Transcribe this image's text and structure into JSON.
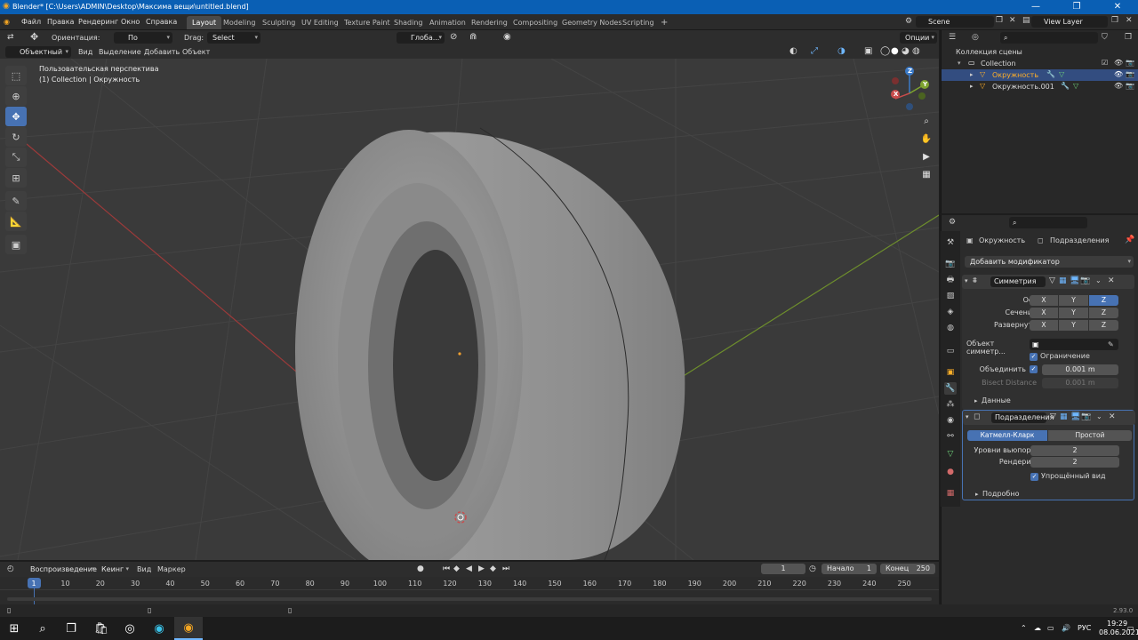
{
  "window": {
    "title": "Blender* [C:\\Users\\ADMIN\\Desktop\\Максима вещи\\untitled.blend]"
  },
  "menu": [
    "Файл",
    "Правка",
    "Рендеринг",
    "Окно",
    "Справка"
  ],
  "workspaces": [
    "Layout",
    "Modeling",
    "Sculpting",
    "UV Editing",
    "Texture Paint",
    "Shading",
    "Animation",
    "Rendering",
    "Compositing",
    "Geometry Nodes",
    "Scripting"
  ],
  "scene": {
    "name": "Scene",
    "view_layer": "View Layer"
  },
  "header3d": {
    "orientation_label": "Ориентация:",
    "orientation_value": "По умолч...",
    "drag_label": "Drag:",
    "drag_value": "Select Box",
    "transform_orientation": "Глоба...",
    "options": "Опции",
    "mode": "Объектный ...",
    "view": "Вид",
    "select": "Выделение",
    "add": "Добавить",
    "object": "Объект"
  },
  "viewport": {
    "perspective": "Пользовательская перспектива",
    "collection_info": "(1) Collection | Окружность",
    "axes": [
      "X",
      "Y",
      "Z"
    ]
  },
  "outliner": {
    "root": "Коллекция сцены",
    "collection": "Collection",
    "items": [
      "Окружность",
      "Окружность.001"
    ]
  },
  "properties": {
    "object_name": "Окружность",
    "context": "Подразделения",
    "add_modifier": "Добавить модификатор",
    "mirror": {
      "name": "Симметрия",
      "axis_label": "Ось",
      "bisect_label": "Сечение",
      "flip_label": "Развернуть",
      "xyz": [
        "X",
        "Y",
        "Z"
      ],
      "mirror_object_label": "Объект симметр...",
      "clipping": "Ограничение",
      "merge_label": "Объединить",
      "merge_value": "0.001 m",
      "bisect_distance_label": "Bisect Distance",
      "bisect_distance_value": "0.001 m",
      "data": "Данные"
    },
    "subsurf": {
      "name": "Подразделения",
      "catmull": "Катмелл-Кларк",
      "simple": "Простой",
      "levels_viewport_label": "Уровни вьюпорта",
      "levels_viewport": "2",
      "render_label": "Рендеринг",
      "render": "2",
      "optimal": "Упрощённый вид",
      "advanced": "Подробно"
    }
  },
  "timeline": {
    "playback": "Воспроизведение",
    "keying": "Кеинг",
    "view": "Вид",
    "marker": "Маркер",
    "current_frame": "1",
    "start_label": "Начало",
    "start": "1",
    "end_label": "Конец",
    "end": "250",
    "ticks": [
      "1",
      "10",
      "20",
      "30",
      "40",
      "50",
      "60",
      "70",
      "80",
      "90",
      "100",
      "110",
      "120",
      "130",
      "140",
      "150",
      "160",
      "170",
      "180",
      "190",
      "200",
      "210",
      "220",
      "230",
      "240",
      "250"
    ]
  },
  "status": {
    "version": "2.93.0"
  },
  "taskbar": {
    "lang": "РУС",
    "time": "19:29",
    "date": "08.06.2021"
  },
  "colors": {
    "accent": "#4772b3",
    "titlebar": "#0a5fb4",
    "viewport": "#3a3a3a"
  }
}
